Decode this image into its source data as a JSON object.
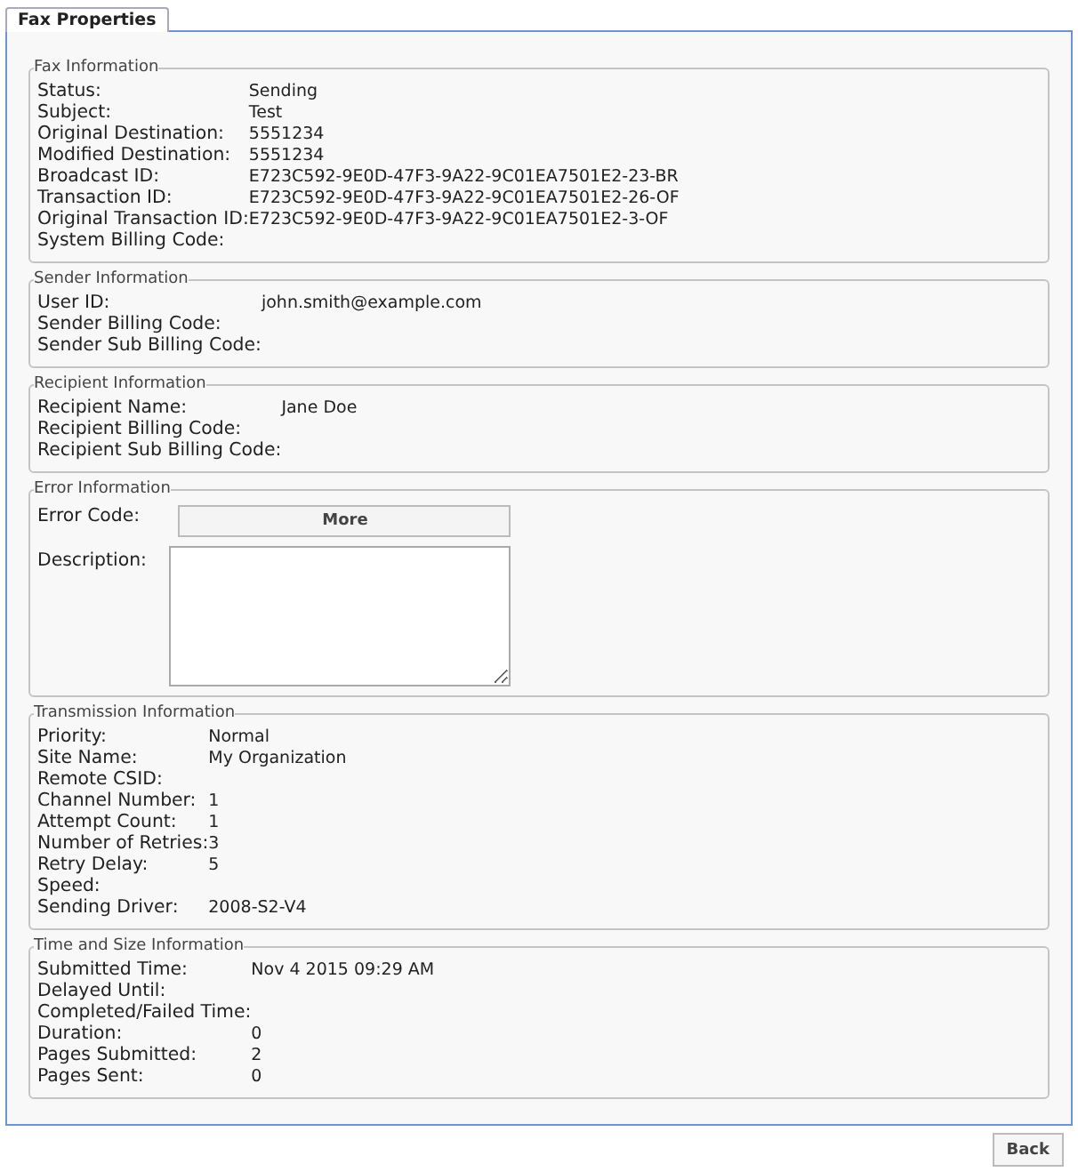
{
  "tabs": [
    {
      "label": "Fax Properties",
      "selected": true
    }
  ],
  "sections": [
    {
      "kind": "fields",
      "legend": "Fax Information",
      "rows": [
        {
          "label": "Status:",
          "value": "Sending"
        },
        {
          "label": "Subject:",
          "value": "Test"
        },
        {
          "label": "Original Destination:",
          "value": "5551234"
        },
        {
          "label": "Modified Destination:",
          "value": "5551234"
        },
        {
          "label": "Broadcast ID:",
          "value": "E723C592-9E0D-47F3-9A22-9C01EA7501E2-23-BR"
        },
        {
          "label": "Transaction ID:",
          "value": "E723C592-9E0D-47F3-9A22-9C01EA7501E2-26-OF"
        },
        {
          "label": "Original Transaction ID:",
          "value": "E723C592-9E0D-47F3-9A22-9C01EA7501E2-3-OF"
        },
        {
          "label": "System Billing Code:"
        }
      ]
    },
    {
      "kind": "fields",
      "legend": "Sender Information",
      "rows": [
        {
          "label": "User ID:",
          "value": "john.smith@example.com"
        },
        {
          "label": "Sender Billing Code:"
        },
        {
          "label": "Sender Sub Billing Code:"
        }
      ]
    },
    {
      "kind": "fields",
      "legend": "Recipient Information",
      "rows": [
        {
          "label": "Recipient Name:",
          "value": "Jane Doe"
        },
        {
          "label": "Recipient Billing Code:"
        },
        {
          "label": "Recipient Sub Billing Code:"
        }
      ]
    },
    {
      "kind": "error",
      "legend": "Error Information",
      "code_label": "Error Code:",
      "button": "More",
      "description_label": "Description:"
    },
    {
      "kind": "fields",
      "legend": "Transmission Information",
      "rows": [
        {
          "label": "Priority:",
          "value": "Normal"
        },
        {
          "label": "Site Name:",
          "value": "My Organization"
        },
        {
          "label": "Remote CSID:"
        },
        {
          "label": "Channel Number:",
          "value": "1"
        },
        {
          "label": "Attempt Count:",
          "value": "1"
        },
        {
          "label": "Number of Retries:",
          "value": "3"
        },
        {
          "label": "Retry Delay:",
          "value": "5"
        },
        {
          "label": "Speed:"
        },
        {
          "label": "Sending Driver:",
          "value": "2008-S2-V4"
        }
      ]
    },
    {
      "kind": "fields",
      "legend": "Time and Size Information",
      "rows": [
        {
          "label": "Submitted Time:",
          "value": "Nov 4 2015 09:29 AM"
        },
        {
          "label": "Delayed Until:"
        },
        {
          "label": "Completed/Failed Time:"
        },
        {
          "label": "Duration:",
          "value": "0"
        },
        {
          "label": "Pages Submitted:",
          "value": "2"
        },
        {
          "label": "Pages Sent:",
          "value": "0"
        }
      ]
    }
  ],
  "footer_button": "Back"
}
